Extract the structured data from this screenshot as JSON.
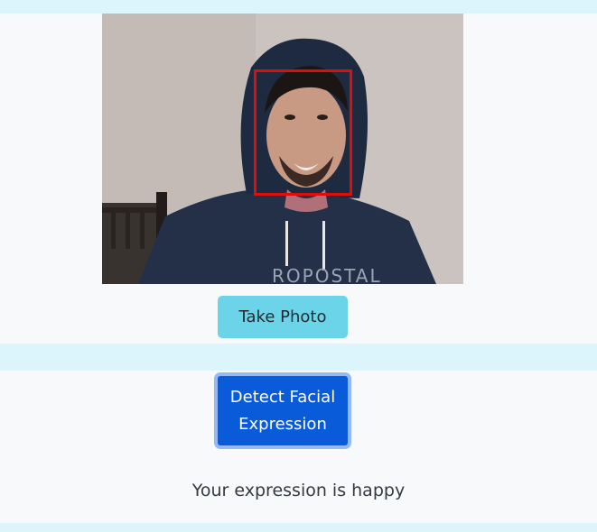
{
  "camera": {
    "snapshot_icon": "webcam-snapshot",
    "face_box_color": "#e00d0d"
  },
  "buttons": {
    "take_photo": "Take Photo",
    "detect": "Detect Facial Expression"
  },
  "result": {
    "text": "Your expression is happy"
  },
  "colors": {
    "page_background": "#dcf4fb",
    "panel_background": "#f8f9fb",
    "take_photo_bg": "#6cd4e8",
    "detect_bg": "#0a5bd9",
    "detect_focus_ring": "#95b9f4"
  }
}
